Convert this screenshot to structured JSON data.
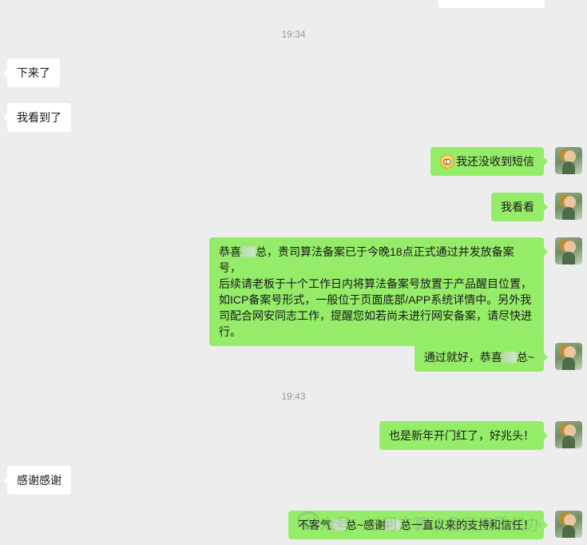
{
  "timestamps": [
    "19:34",
    "19:43"
  ],
  "messages": {
    "m1": "下来了",
    "m2": "我看到了",
    "m3": "我还没收到短信",
    "m3_emoji": "emoji-face-icon",
    "m4": "我看看",
    "m5_a": "恭喜",
    "m5_b": "总，贵司算法备案已于今晚18点正式通过并发放备案号，",
    "m5_line2": "后续请老板于十个工作日内将算法备案号放置于产品醒目位置，",
    "m5_line3": "如ICP备案号形式，一般位于页面底部/APP系统详情中。另外我",
    "m5_line4": "司配合网安同志工作，提醒您如若尚未进行网安备案，请尽快进",
    "m5_line5": "行。",
    "m6_a": "通过就好，恭喜",
    "m6_b": "总~",
    "m7": "也是新年开门红了，好兆头！",
    "m8": "感谢感谢",
    "m9_a": "不客气",
    "m9_b": "总~感谢",
    "m9_c": "总一直以来的支持和信任！"
  },
  "watermark": "公众号 · 过河方算法备案资质代办",
  "colors": {
    "background": "#ededed",
    "incoming_bubble": "#ffffff",
    "outgoing_bubble": "#95ec69",
    "timestamp_text": "#9b9b9b"
  }
}
